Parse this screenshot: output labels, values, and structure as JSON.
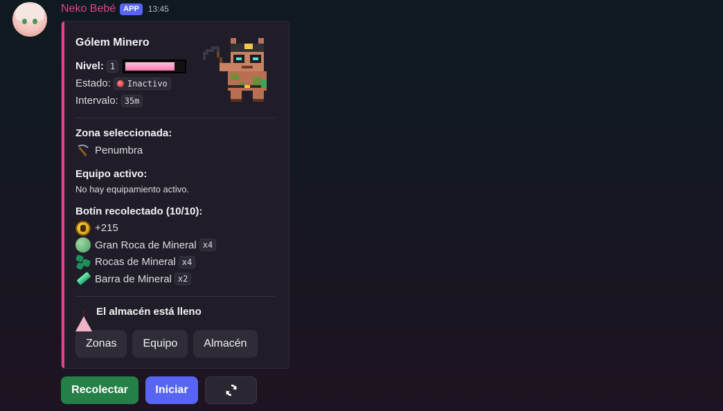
{
  "message": {
    "username": "Neko Bebé",
    "badge": "APP",
    "timestamp": "13:45"
  },
  "embed": {
    "accent_color": "#e8408a",
    "title": "Gólem Minero",
    "level_label": "Nivel:",
    "level_value": "1",
    "level_progress": 0.85,
    "status_label": "Estado:",
    "status_value": "Inactivo",
    "interval_label": "Intervalo:",
    "interval_value": "35m",
    "zone_heading": "Zona seleccionada:",
    "zone_value": "Penumbra",
    "equipment_heading": "Equipo activo:",
    "equipment_value": "No hay equipamiento activo.",
    "loot_heading": "Botín recolectado (10/10):",
    "loot": [
      {
        "icon": "coin-icon",
        "label": "+215",
        "qty": ""
      },
      {
        "icon": "big-rock-icon",
        "label": "Gran Roca de Mineral",
        "qty": "x4"
      },
      {
        "icon": "rocks-icon",
        "label": "Rocas de Mineral",
        "qty": "x4"
      },
      {
        "icon": "ingot-icon",
        "label": "Barra de Mineral",
        "qty": "x2"
      }
    ],
    "warning": "El almacén está lleno",
    "buttons": [
      "Zonas",
      "Equipo",
      "Almacén"
    ]
  },
  "actions": {
    "collect": "Recolectar",
    "start": "Iniciar",
    "refresh_icon": "refresh-icon"
  }
}
